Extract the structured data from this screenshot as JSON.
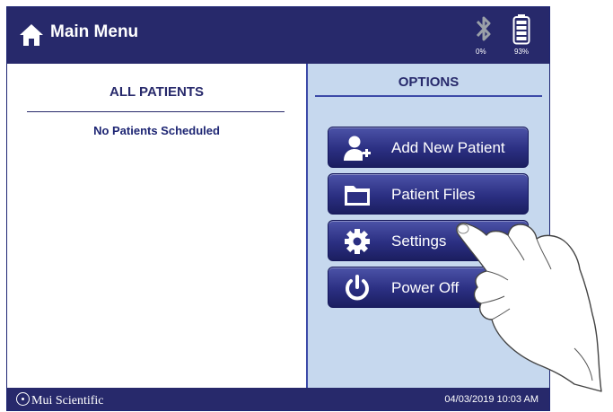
{
  "header": {
    "title": "Main Menu",
    "bluetooth_level": "0%",
    "battery_level": "93%"
  },
  "left_panel": {
    "title": "ALL PATIENTS",
    "empty_message": "No Patients Scheduled"
  },
  "right_panel": {
    "title": "OPTIONS",
    "buttons": [
      {
        "label": "Add New Patient",
        "icon": "add-user-icon"
      },
      {
        "label": "Patient Files",
        "icon": "folder-icon"
      },
      {
        "label": "Settings",
        "icon": "gear-icon"
      },
      {
        "label": "Power Off",
        "icon": "power-icon"
      }
    ]
  },
  "footer": {
    "brand": "Mui Scientific",
    "datetime": "04/03/2019 10:03 AM"
  },
  "colors": {
    "primary": "#27296b",
    "options_bg": "#c6d8ee"
  }
}
